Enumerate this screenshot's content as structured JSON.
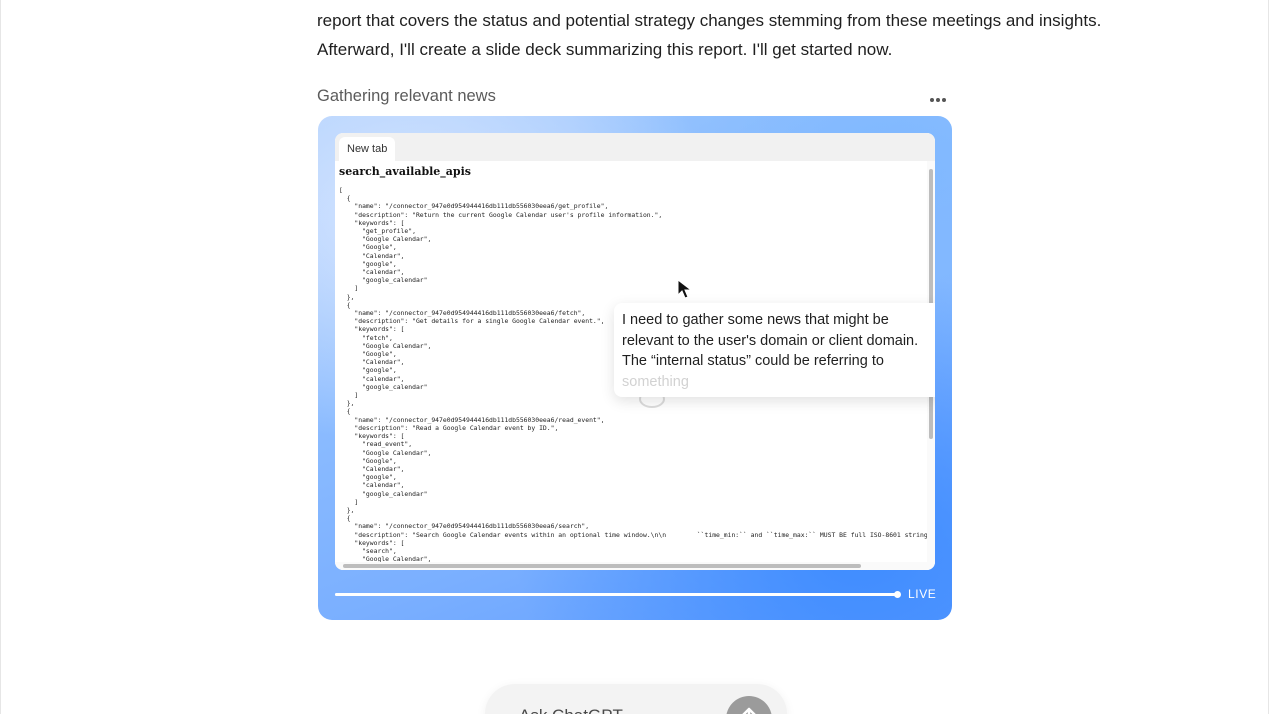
{
  "message": {
    "line1": "report that covers the status and potential strategy changes stemming from these meetings and insights.",
    "line2": "Afterward, I'll create a slide deck summarizing this report. I'll get started now."
  },
  "step": {
    "title": "Gathering relevant news",
    "more_icon": "more-horizontal-icon"
  },
  "browser": {
    "tab_label": "New tab",
    "page_title": "search_available_apis",
    "json_lines": [
      "[",
      "  {",
      "    \"name\": \"/connector_947e0d954944416db111db556030eea6/get_profile\",",
      "    \"description\": \"Return the current Google Calendar user's profile information.\",",
      "    \"keywords\": [",
      "      \"get_profile\",",
      "      \"Google Calendar\",",
      "      \"Google\",",
      "      \"Calendar\",",
      "      \"google\",",
      "      \"calendar\",",
      "      \"google_calendar\"",
      "    ]",
      "  },",
      "  {",
      "    \"name\": \"/connector_947e0d954944416db111db556030eea6/fetch\",",
      "    \"description\": \"Get details for a single Google Calendar event.\",",
      "    \"keywords\": [",
      "      \"fetch\",",
      "      \"Google Calendar\",",
      "      \"Google\",",
      "      \"Calendar\",",
      "      \"google\",",
      "      \"calendar\",",
      "      \"google_calendar\"",
      "    ]",
      "  },",
      "  {",
      "    \"name\": \"/connector_947e0d954944416db111db556030eea6/read_event\",",
      "    \"description\": \"Read a Google Calendar event by ID.\",",
      "    \"keywords\": [",
      "      \"read_event\",",
      "      \"Google Calendar\",",
      "      \"Google\",",
      "      \"Calendar\",",
      "      \"google\",",
      "      \"calendar\",",
      "      \"google_calendar\"",
      "    ]",
      "  },",
      "  {",
      "    \"name\": \"/connector_947e0d954944416db111db556030eea6/search\",",
      "    \"description\": \"Search Google Calendar events within an optional time window.\\n\\n        ``time_min:`` and ``time_max:`` MUST BE full ISO-8601 strings (YYYY-M",
      "    \"keywords\": [",
      "      \"search\",",
      "      \"Google Calendar\","
    ]
  },
  "thought": {
    "text": "I need to gather some news that might be relevant to the user's domain or client domain. The “internal status” could be referring to ",
    "faded": "something"
  },
  "playback": {
    "live_label": "LIVE",
    "progress": 1.0
  },
  "composer": {
    "placeholder": "Ask ChatGPT"
  },
  "colors": {
    "card_gradient_start": "#a9cdfd",
    "card_gradient_end": "#5e9cff",
    "send_button": "#9b9b9b"
  }
}
